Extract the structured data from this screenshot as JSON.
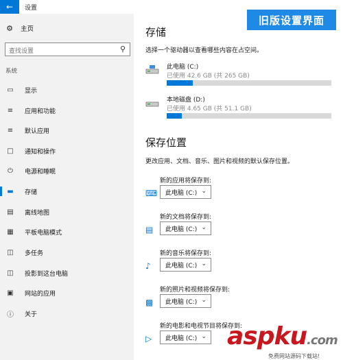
{
  "window": {
    "title": "设置",
    "back_icon": "arrow-left-icon"
  },
  "badge": {
    "text": "旧版设置界面",
    "color": "#1f8ae6"
  },
  "sidebar": {
    "home": {
      "label": "主页",
      "icon": "gear-icon"
    },
    "search": {
      "placeholder": "查找设置",
      "icon": "search-icon"
    },
    "section": "系统",
    "items": [
      {
        "label": "显示",
        "icon": "monitor-icon"
      },
      {
        "label": "应用和功能",
        "icon": "list-icon"
      },
      {
        "label": "默认应用",
        "icon": "default-apps-icon"
      },
      {
        "label": "通知和操作",
        "icon": "notification-icon"
      },
      {
        "label": "电源和睡眠",
        "icon": "power-icon"
      },
      {
        "label": "存储",
        "icon": "storage-icon",
        "active": true
      },
      {
        "label": "离线地图",
        "icon": "map-icon"
      },
      {
        "label": "平板电脑模式",
        "icon": "tablet-icon"
      },
      {
        "label": "多任务",
        "icon": "multitask-icon"
      },
      {
        "label": "投影到这台电脑",
        "icon": "project-icon"
      },
      {
        "label": "网站的应用",
        "icon": "web-app-icon"
      },
      {
        "label": "关于",
        "icon": "info-icon"
      }
    ]
  },
  "storage": {
    "title": "存储",
    "description": "选择一个驱动器以查看哪些内容在占空间。",
    "drives": [
      {
        "name": "此电脑 (C:)",
        "usage": "已使用 42.6 GB (共 265 GB)",
        "used_fraction": 0.16,
        "icon": "system-drive-icon"
      },
      {
        "name": "本地磁盘 (D:)",
        "usage": "已使用 4.65 GB (共 51.1 GB)",
        "used_fraction": 0.09,
        "icon": "local-drive-icon"
      }
    ]
  },
  "save_locations": {
    "title": "保存位置",
    "description": "更改应用、文档、音乐、图片和视频的默认保存位置。",
    "items": [
      {
        "label": "新的应用将保存到:",
        "value": "此电脑 (C:)",
        "icon": "keyboard-icon"
      },
      {
        "label": "新的文档将保存到:",
        "value": "此电脑 (C:)",
        "icon": "folder-icon"
      },
      {
        "label": "新的音乐将保存到:",
        "value": "此电脑 (C:)",
        "icon": "music-note-icon"
      },
      {
        "label": "新的照片和视频将保存到:",
        "value": "此电脑 (C:)",
        "icon": "picture-icon"
      },
      {
        "label": "新的电影和电视节目将保存到:",
        "value": "此电脑 (C:)",
        "icon": "video-icon"
      }
    ]
  },
  "watermark": {
    "logo_main": "asp",
    "logo_ku": "ku",
    "logo_dot": ".com",
    "subtitle": "免费网站源码下载站!"
  },
  "colors": {
    "accent": "#0078d7",
    "sidebar_bg": "#f2f2f2",
    "track": "#d9d9d9"
  }
}
